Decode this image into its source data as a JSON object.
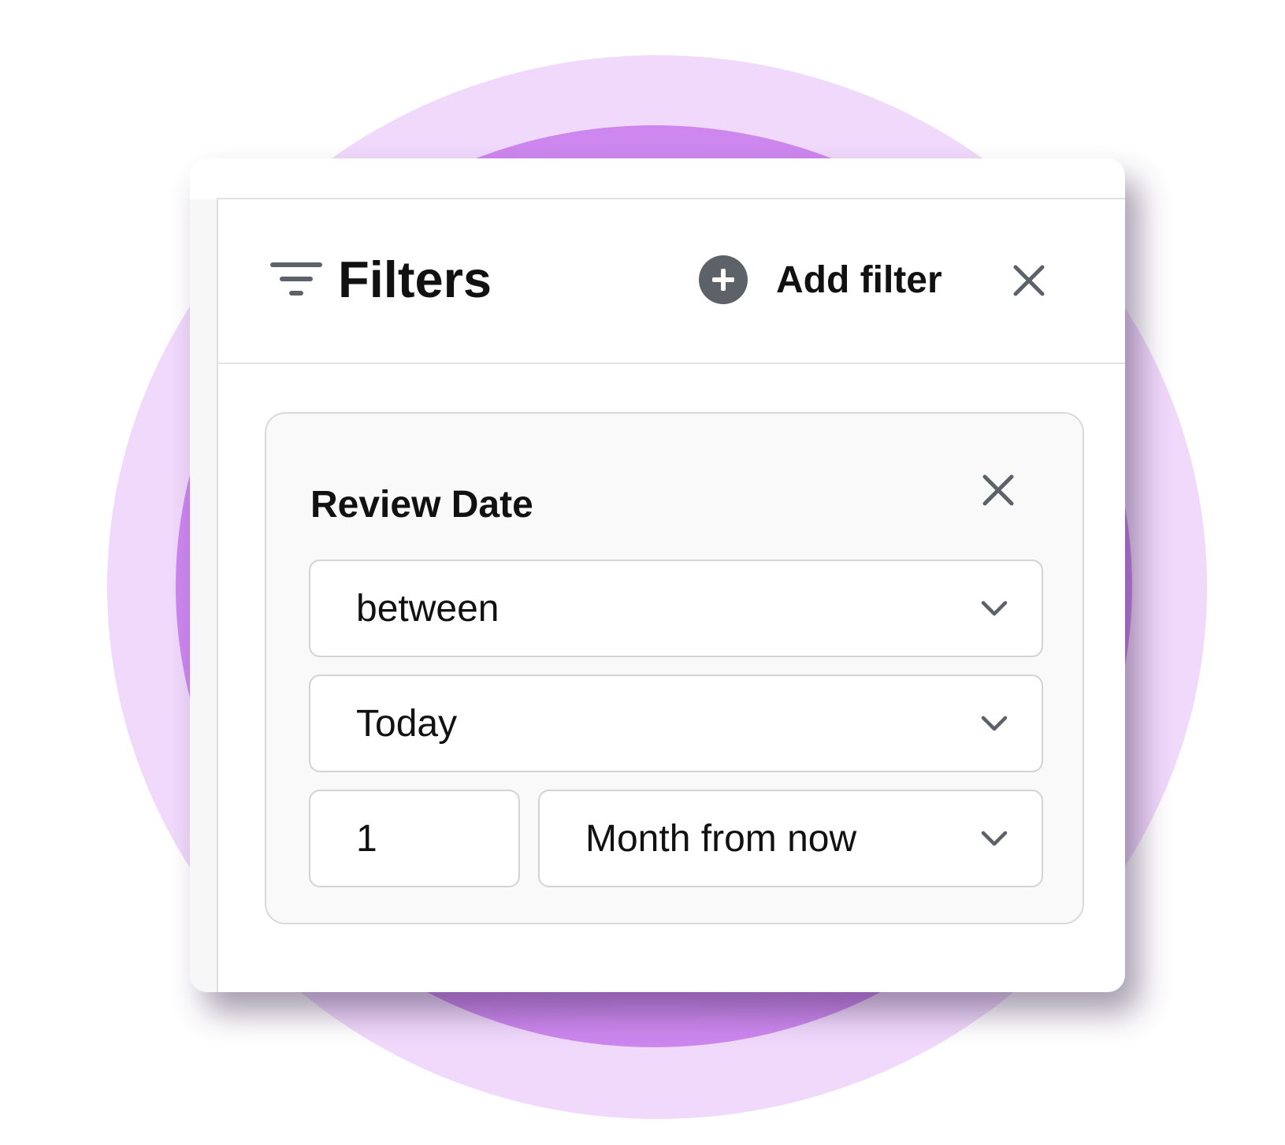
{
  "header": {
    "title": "Filters",
    "title_icon": "filter-lines-icon",
    "add_filter_label": "Add filter",
    "add_filter_icon": "plus-circle-icon",
    "close_icon": "close-icon"
  },
  "filter": {
    "title": "Review Date",
    "remove_icon": "close-icon",
    "operator": {
      "value": "between",
      "icon": "chevron-down-icon"
    },
    "from": {
      "value": "Today",
      "icon": "chevron-down-icon"
    },
    "to_amount": {
      "value": "1"
    },
    "to_unit": {
      "value": "Month from now",
      "icon": "chevron-down-icon"
    }
  },
  "colors": {
    "background_outer": "#f0d9fb",
    "background_inner": "#cf8bf0",
    "icon_gray": "#5d6168",
    "text": "#111111"
  }
}
